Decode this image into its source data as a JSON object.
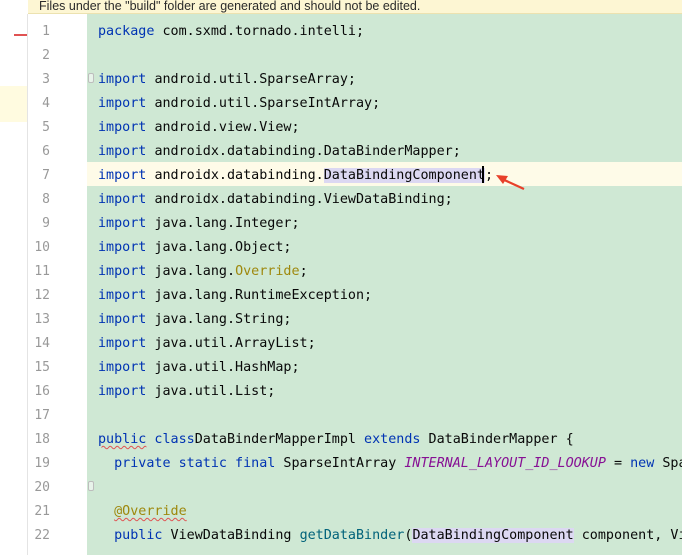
{
  "banner": {
    "text": "Files under the \"build\" folder are generated and should not be edited."
  },
  "colors": {
    "editor_bg": "#cfe8d4",
    "current_line": "#fefbe8",
    "keyword": "#0033b3",
    "annotation": "#9e880d",
    "arrow": "#e8402a"
  },
  "lines": [
    {
      "n": "1",
      "parts": [
        [
          "kw",
          "package"
        ],
        [
          "",
          "com.sxmd.tornado.intelli;"
        ]
      ]
    },
    {
      "n": "2",
      "parts": []
    },
    {
      "n": "3",
      "parts": [
        [
          "kw",
          "import"
        ],
        [
          "",
          "android.util.SparseArray;"
        ]
      ]
    },
    {
      "n": "4",
      "parts": [
        [
          "kw",
          "import"
        ],
        [
          "",
          "android.util.SparseIntArray;"
        ]
      ]
    },
    {
      "n": "5",
      "parts": [
        [
          "kw",
          "import"
        ],
        [
          "",
          "android.view.View;"
        ]
      ]
    },
    {
      "n": "6",
      "parts": [
        [
          "kw",
          "import"
        ],
        [
          "",
          "androidx.databinding.DataBinderMapper;"
        ]
      ]
    },
    {
      "n": "7",
      "parts": [
        [
          "kw",
          "import"
        ],
        [
          "",
          "androidx.databinding."
        ],
        [
          "sel",
          "DataBindingComponent"
        ],
        [
          "",
          ";"
        ]
      ]
    },
    {
      "n": "8",
      "parts": [
        [
          "kw",
          "import"
        ],
        [
          "",
          "androidx.databinding.ViewDataBinding;"
        ]
      ]
    },
    {
      "n": "9",
      "parts": [
        [
          "kw",
          "import"
        ],
        [
          "",
          "java.lang.Integer;"
        ]
      ]
    },
    {
      "n": "10",
      "parts": [
        [
          "kw",
          "import"
        ],
        [
          "",
          "java.lang.Object;"
        ]
      ]
    },
    {
      "n": "11",
      "parts": [
        [
          "kw",
          "import"
        ],
        [
          "",
          "java.lang."
        ],
        [
          "ovr",
          "Override"
        ],
        [
          "",
          ";"
        ]
      ]
    },
    {
      "n": "12",
      "parts": [
        [
          "kw",
          "import"
        ],
        [
          "",
          "java.lang.RuntimeException;"
        ]
      ]
    },
    {
      "n": "13",
      "parts": [
        [
          "kw",
          "import"
        ],
        [
          "",
          "java.lang.String;"
        ]
      ]
    },
    {
      "n": "14",
      "parts": [
        [
          "kw",
          "import"
        ],
        [
          "",
          "java.util.ArrayList;"
        ]
      ]
    },
    {
      "n": "15",
      "parts": [
        [
          "kw",
          "import"
        ],
        [
          "",
          "java.util.HashMap;"
        ]
      ]
    },
    {
      "n": "16",
      "parts": [
        [
          "kw",
          "import"
        ],
        [
          "",
          "java.util.List;"
        ]
      ]
    },
    {
      "n": "17",
      "parts": []
    },
    {
      "n": "18",
      "parts": [
        [
          "kw squig",
          "public"
        ],
        [
          "kw",
          " class"
        ],
        [
          "",
          ""
        ],
        [
          "",
          "DataBinderMapperImpl"
        ],
        [
          "kw",
          " extends"
        ],
        [
          "",
          " DataBinderMapper {"
        ]
      ]
    },
    {
      "n": "19",
      "parts": [
        [
          "",
          "  "
        ],
        [
          "kw",
          "private static final"
        ],
        [
          "",
          " SparseIntArray "
        ],
        [
          "itl",
          "INTERNAL_LAYOUT_ID_LOOKUP"
        ],
        [
          "",
          " = "
        ],
        [
          "kw",
          "new"
        ],
        [
          "",
          " Spa"
        ]
      ]
    },
    {
      "n": "20",
      "parts": []
    },
    {
      "n": "21",
      "parts": [
        [
          "",
          "  "
        ],
        [
          "ann squig",
          "@Override"
        ]
      ]
    },
    {
      "n": "22",
      "parts": [
        [
          "",
          "  "
        ],
        [
          "kw",
          "public"
        ],
        [
          "",
          " ViewDataBinding "
        ],
        [
          "mth",
          "getDataBinder"
        ],
        [
          "",
          "("
        ],
        [
          "sel",
          "DataBindingComponent"
        ],
        [
          "",
          " component, Vi"
        ]
      ]
    }
  ]
}
